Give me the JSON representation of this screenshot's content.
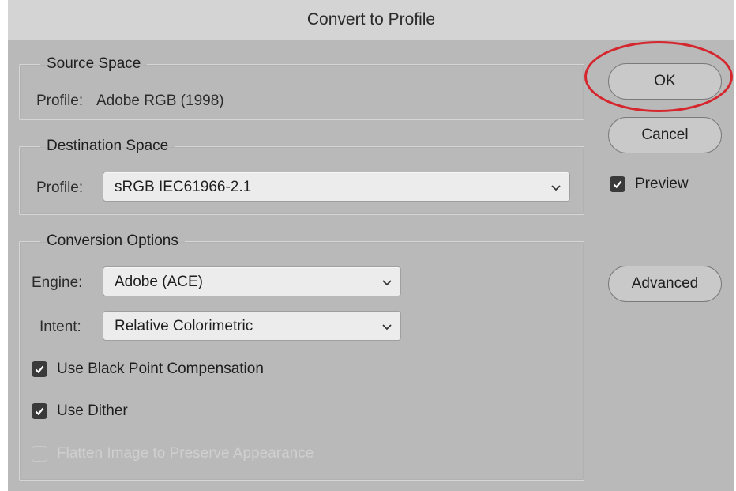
{
  "dialog": {
    "title": "Convert to Profile"
  },
  "source_space": {
    "legend": "Source Space",
    "profile_label": "Profile:",
    "profile_value": "Adobe RGB (1998)"
  },
  "destination_space": {
    "legend": "Destination Space",
    "profile_label": "Profile:",
    "profile_selected": "sRGB IEC61966-2.1"
  },
  "conversion_options": {
    "legend": "Conversion Options",
    "engine_label": "Engine:",
    "engine_selected": "Adobe (ACE)",
    "intent_label": "Intent:",
    "intent_selected": "Relative Colorimetric",
    "black_point": {
      "label": "Use Black Point Compensation",
      "checked": true
    },
    "dither": {
      "label": "Use Dither",
      "checked": true
    },
    "flatten": {
      "label": "Flatten Image to Preserve Appearance",
      "checked": false,
      "disabled": true
    }
  },
  "buttons": {
    "ok": "OK",
    "cancel": "Cancel",
    "advanced": "Advanced"
  },
  "preview": {
    "label": "Preview",
    "checked": true
  },
  "colors": {
    "dialog_bg": "#b9b9b9",
    "highlight_circle": "#d6262d",
    "checkbox_fill": "#3a3a3a"
  }
}
